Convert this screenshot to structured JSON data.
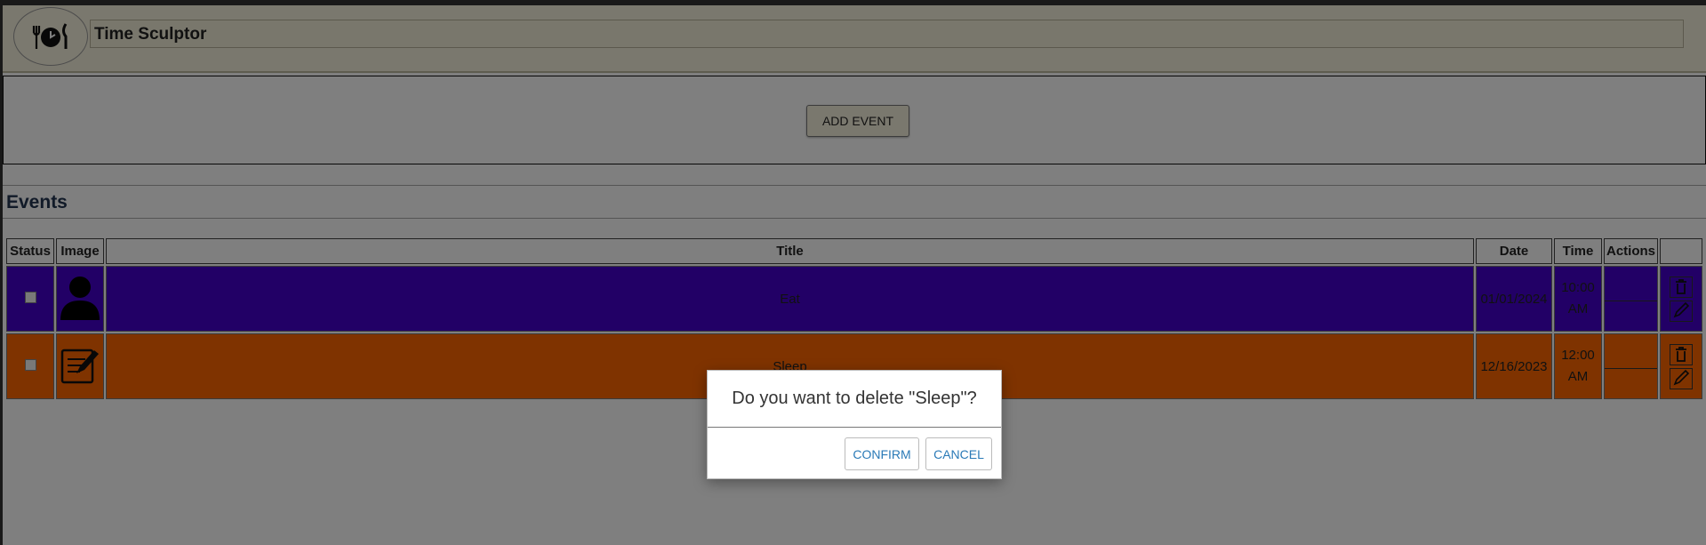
{
  "app": {
    "title": "Time Sculptor",
    "logo_icon": "clock-with-fork-and-knife-icon"
  },
  "add_section": {
    "add_button_label": "ADD EVENT"
  },
  "events": {
    "heading": "Events",
    "columns": [
      "Status",
      "Image",
      "Title",
      "Date",
      "Time",
      "Actions"
    ],
    "rows": [
      {
        "title": "Eat",
        "date": "01/01/2024",
        "time_line1": "10:00",
        "time_line2": "AM",
        "color": "#4400cc",
        "image_icon": "person-icon",
        "checked": false
      },
      {
        "title": "Sleep",
        "date": "12/16/2023",
        "time_line1": "12:00",
        "time_line2": "AM",
        "color": "#ff6600",
        "image_icon": "notepad-pencil-icon",
        "checked": false
      }
    ],
    "row_action_icons": [
      "trash-icon",
      "edit-icon"
    ]
  },
  "dialog": {
    "message": "Do you want to delete \"Sleep\"?",
    "confirm_label": "CONFIRM",
    "cancel_label": "CANCEL"
  },
  "colors": {
    "header_bg": "#f5f0dc",
    "eat_row": "#4400cc",
    "sleep_row": "#ff6600",
    "dialog_button_text": "#2a7ab7"
  }
}
